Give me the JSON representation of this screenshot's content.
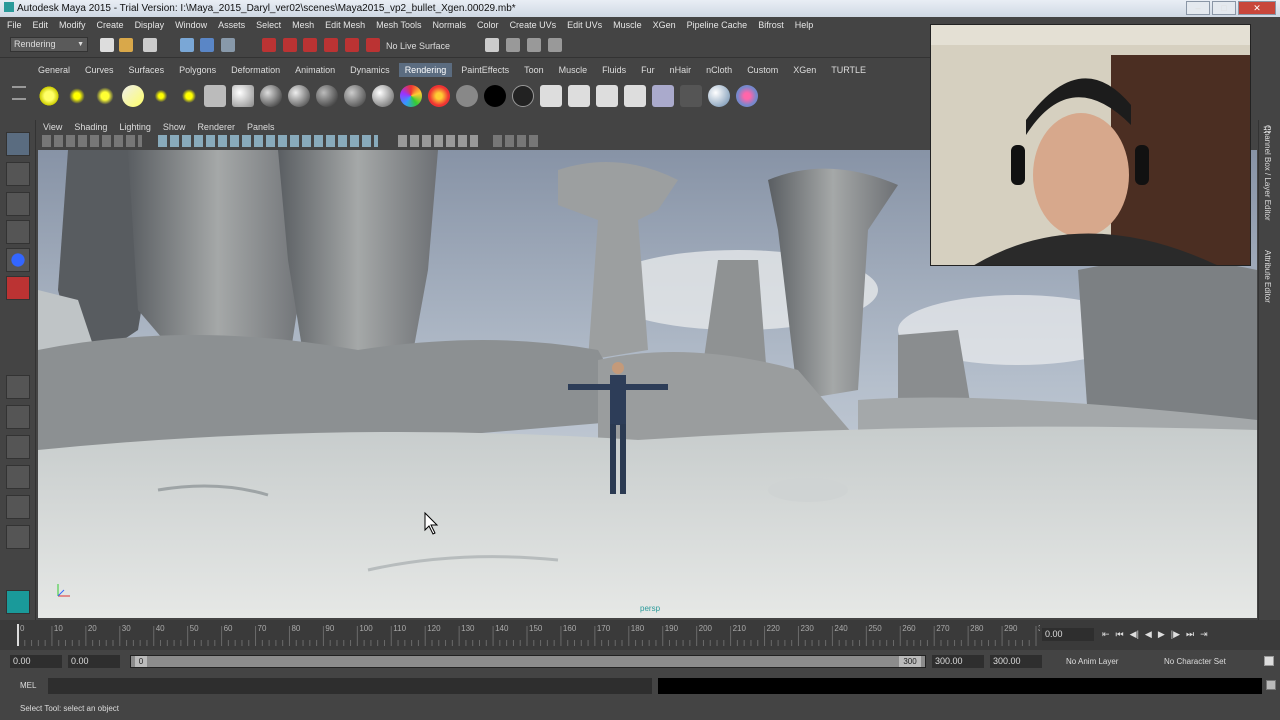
{
  "window": {
    "title": "Autodesk Maya 2015 - Trial Version: I:\\Maya_2015_Daryl_ver02\\scenes\\Maya2015_vp2_bullet_Xgen.00029.mb*"
  },
  "menubar": [
    "File",
    "Edit",
    "Modify",
    "Create",
    "Display",
    "Window",
    "Assets",
    "Select",
    "Mesh",
    "Edit Mesh",
    "Mesh Tools",
    "Normals",
    "Color",
    "Create UVs",
    "Edit UVs",
    "Muscle",
    "XGen",
    "Pipeline Cache",
    "Bifrost",
    "Help"
  ],
  "status_line": {
    "menu_set": "Rendering",
    "live_surface": "No Live Surface"
  },
  "shelf": {
    "tabs": [
      "General",
      "Curves",
      "Surfaces",
      "Polygons",
      "Deformation",
      "Animation",
      "Dynamics",
      "Rendering",
      "PaintEffects",
      "Toon",
      "Muscle",
      "Fluids",
      "Fur",
      "nHair",
      "nCloth",
      "Custom",
      "XGen",
      "TURTLE"
    ],
    "active_tab": "Rendering"
  },
  "panel_menu": [
    "View",
    "Shading",
    "Lighting",
    "Show",
    "Renderer",
    "Panels"
  ],
  "viewport": {
    "camera_label": "persp"
  },
  "side_tabs": [
    "Channel Box / Layer Editor",
    "Attribute Editor"
  ],
  "timeline": {
    "ticks": [
      "0",
      "10",
      "20",
      "30",
      "40",
      "50",
      "60",
      "70",
      "80",
      "90",
      "100",
      "110",
      "120",
      "130",
      "140",
      "150",
      "160",
      "170",
      "180",
      "190",
      "200",
      "210",
      "220",
      "230",
      "240",
      "250",
      "260",
      "270",
      "280",
      "290",
      "30"
    ],
    "current_frame": "0.00",
    "playhead": 0
  },
  "range_slider": {
    "start_time": "0.00",
    "playback_start": "0.00",
    "range_start_label": "0",
    "range_end_label": "300",
    "playback_end": "300.00",
    "end_time": "300.00",
    "anim_layer": "No Anim Layer",
    "character_set": "No Character Set"
  },
  "command_line": {
    "label": "MEL"
  },
  "help_line": "Select Tool: select an object",
  "colors": {
    "ui_bg": "#444444",
    "active_tab": "#5b6c80",
    "sky": "#aab6c6",
    "snow": "#dfe3e2"
  }
}
